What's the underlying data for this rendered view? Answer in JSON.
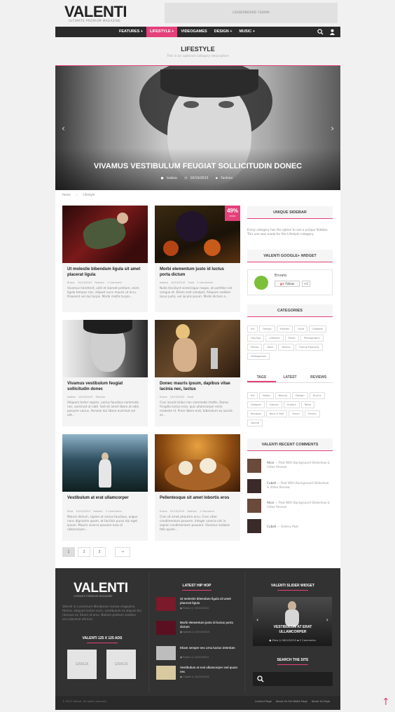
{
  "header": {
    "logo": "VALENTI",
    "tagline": "ULTIMATE PREMIUM MAGAZINE",
    "leaderboard": "LEADERBOARD 728X90"
  },
  "nav": {
    "items": [
      {
        "label": "FEATURES +",
        "active": false
      },
      {
        "label": "LIFESTYLE +",
        "active": true
      },
      {
        "label": "VIDEOGAMES",
        "active": false
      },
      {
        "label": "DESIGN +",
        "active": false
      },
      {
        "label": "MUSIC +",
        "active": false
      }
    ]
  },
  "category": {
    "title": "LIFESTYLE",
    "description": "This is an optional category description"
  },
  "hero": {
    "title": "VIVAMUS VESTIBULUM FEUGIAT SOLLICITUDIN DONEC",
    "author": "Isobea",
    "date": "10/10/2015",
    "category": "Fashion"
  },
  "breadcrumb": [
    "Home",
    "Lifestyle"
  ],
  "posts": [
    {
      "title": "Ut molestie bibendum ligula sit amet placerat ligula",
      "author": "Rubra",
      "date": "10/10/2015",
      "cat": "Fashion",
      "comments": "1 Comment",
      "excerpt": "Vivamus hendrerit, velit et laoreet pretium, enim ligula tempus nec, aliquet nunc mauris ut arcu. Praesent vel dui turpis. Morbi mattis turpis..."
    },
    {
      "title": "Morbi elementum justo id luctus porta dictum",
      "author": "Isobea",
      "date": "10/10/2015",
      "cat": "Food",
      "comments": "2 Comments",
      "excerpt": "Nulla tincidunt scelerisque neque, at porttitor est congue et. Etiam erat volutpat. Aliquam sodales lacus justo, vel iaculis ipsum. Morbi dictum a...",
      "score": "49%",
      "score_label": "POOR"
    },
    {
      "title": "Vivamus vestibulum feugiat sollicitudin donec",
      "author": "Isobea",
      "date": "10/10/2015",
      "cat": "Fashion",
      "comments": "",
      "excerpt": "Aliquam tortor sapien, varius faucibus commodo nec, euismod ut nibh. Sed sit amet libero at odio posuere varius. Aenean dui libero euismod vel elit..."
    },
    {
      "title": "Donec mauris ipsum, dapibus vitae lacinia nec, luctus",
      "author": "Evans",
      "date": "10/10/2015",
      "cat": "Food",
      "comments": "",
      "excerpt": "Cras iaculis tellus non commodo mattis. Donec fringilla luctus eros, quis ullamcorper enim molestie id. Proin libero erat, bibendum eu iaculis et..."
    },
    {
      "title": "Vestibulum at erat ullamcorper",
      "author": "Eliza",
      "date": "10/10/2015",
      "cat": "Fashion",
      "comments": "2 Comments",
      "excerpt": "Mauris dictum, sapien at varius faucibus, augue nunc dignissim quam, at facilisis purus dui eget ipsum. Mauris viverra posuere eros id ullamcorper..."
    },
    {
      "title": "Pellentesque sit amet lobortis eros",
      "author": "Evans",
      "date": "07/10/2015",
      "cat": "Fashion",
      "comments": "1 Comment",
      "excerpt": "Cras sit amet pharetra arcu. Cras vitae condimentum posuere. Integer viverra nisi in sapien condimentum posuere. Vivamus sodales felis quam..."
    }
  ],
  "pagination": [
    "1",
    "2",
    "3",
    "→"
  ],
  "sidebar": {
    "unique_title": "UNIQUE SIDEBAR",
    "unique_text": "Every category has the option to use a unique Sidebar. This one was made for the Lifestyle category.",
    "gplus_title": "VALENTI GOOGLE+ WIDGET",
    "gplus_name": "Envato",
    "gplus_follow": "Follow",
    "gplus_count": "+1",
    "categories_title": "CATEGORIES",
    "categories": [
      "Art",
      "Design",
      "Fashion",
      "Food",
      "Gadgets",
      "Hip-Hop",
      "Lifestyle",
      "Music",
      "Photography",
      "Places",
      "Rock",
      "Techno",
      "Theme Features",
      "Videogames"
    ],
    "tabs": [
      "TAGS",
      "LATEST",
      "REVIEWS"
    ],
    "tags": [
      "Art",
      "Beats",
      "Beauty",
      "Design",
      "Drums",
      "Gadgets",
      "Games",
      "Guitars",
      "Retro",
      "Reviews",
      "Rock & Roll",
      "Travel",
      "Trendy",
      "Valenti"
    ],
    "comments_title": "VALENTI RECENT COMMENTS",
    "comments": [
      {
        "who": "Alice",
        "on": "Post With Background Slideshow & Video Review"
      },
      {
        "who": "Cubell",
        "on": "Post With Background Slideshow & Video Review"
      },
      {
        "who": "Alice",
        "on": "Post With Background Slideshow & Video Review"
      },
      {
        "who": "Cubell",
        "on": "Gallery Post"
      }
    ]
  },
  "footer": {
    "logo": "VALENTI",
    "tagline": "ULTIMATE PREMIUM MAGAZINE",
    "about": "Valenti is a premium Wordpress review magazine theme, aliquam tortor nunc, vestibulum et aliquet dui rhoncus ut. Etiam id arcu. Nullam pretium sodales orci placerat ultrices.",
    "ads_title": "VALENTI 125 X 125 ADS",
    "ad1": "125X125",
    "ad2": "125X125",
    "hiphop_title": "LATEST HIP HOP",
    "hiphop": [
      {
        "title": "Ut molestie bibendum ligula sit amet placerat ligula",
        "author": "Rubra",
        "date": "10/10/2015"
      },
      {
        "title": "Morbi elementum justo id luctus porta dictum",
        "author": "Isobea",
        "date": "10/10/2015"
      },
      {
        "title": "Etiam semper nec urna luctus interdum",
        "author": "Rubra",
        "date": "10/10/2015"
      },
      {
        "title": "Vestibulum at erat ullamcorper sed quam nec",
        "author": "Cubell",
        "date": "10/10/2015"
      }
    ],
    "slider_title": "VALENTI SLIDER WIDGET",
    "slider_caption": "VESTIBULUM AT ERAT ULLAMCORPER",
    "slider_author": "Eliza",
    "slider_date": "08/10/2015",
    "slider_comments": "2 Comments",
    "search_title": "SEARCH THE SITE",
    "copyright": "© 2015 Valenti. All rights reserved.",
    "links": [
      "Contact Page",
      "About Us Full-Width Page",
      "About Us Page"
    ]
  },
  "colors": {
    "accent": "#e4407a",
    "dark": "#2a2a2a"
  }
}
